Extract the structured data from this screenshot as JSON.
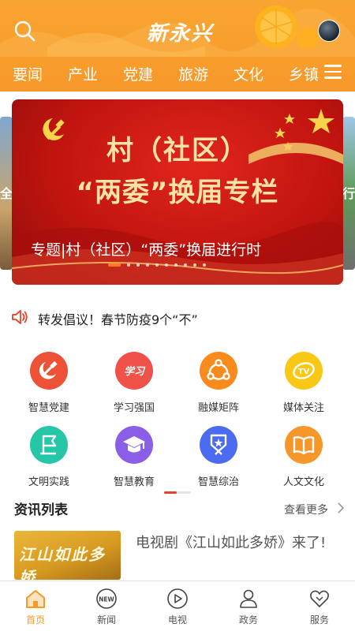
{
  "header": {
    "logo_text": "新永兴",
    "nav": [
      "要闻",
      "产业",
      "党建",
      "旅游",
      "文化",
      "乡镇"
    ],
    "colors": {
      "header_bg": "#f9a531",
      "accent": "#f7982a"
    }
  },
  "banner": {
    "left_peek_text": "全",
    "right_peek_text": "行",
    "title_line1": "村（社区）",
    "title_line2": "“两委”换届专栏",
    "caption": "专题|村（社区）“两委”换届进行时",
    "slide_count": 10,
    "active_slide": 1
  },
  "notice": {
    "icon": "speaker-icon",
    "text": "转发倡议！春节防疫9个“不”"
  },
  "features": [
    {
      "label": "智慧党建",
      "icon": "party-emblem-icon",
      "color": "#ee5236"
    },
    {
      "label": "学习强国",
      "icon": "study-icon",
      "color": "#f0524a"
    },
    {
      "label": "融媒矩阵",
      "icon": "share-network-icon",
      "color": "#f98a1c"
    },
    {
      "label": "媒体关注",
      "icon": "tv-icon",
      "color": "#f9c715"
    },
    {
      "label": "文明实践",
      "icon": "flag-icon",
      "color": "#25c7a6"
    },
    {
      "label": "智慧教育",
      "icon": "graduation-cap-icon",
      "color": "#8a5ee6"
    },
    {
      "label": "智慧综治",
      "icon": "badge-icon",
      "color": "#4b6cf1"
    },
    {
      "label": "人文文化",
      "icon": "book-icon",
      "color": "#f5972a"
    }
  ],
  "news": {
    "section_title": "资讯列表",
    "more_label": "查看更多",
    "thumb_text": "江山如此多娇",
    "items": [
      {
        "title": "电视剧《江山如此多娇》来了!"
      }
    ]
  },
  "tabbar": [
    {
      "label": "首页",
      "icon": "home-icon",
      "active": true
    },
    {
      "label": "新闻",
      "icon": "news-icon",
      "badge": "NEW"
    },
    {
      "label": "电视",
      "icon": "play-icon"
    },
    {
      "label": "政务",
      "icon": "person-icon"
    },
    {
      "label": "服务",
      "icon": "heart-icon"
    }
  ]
}
